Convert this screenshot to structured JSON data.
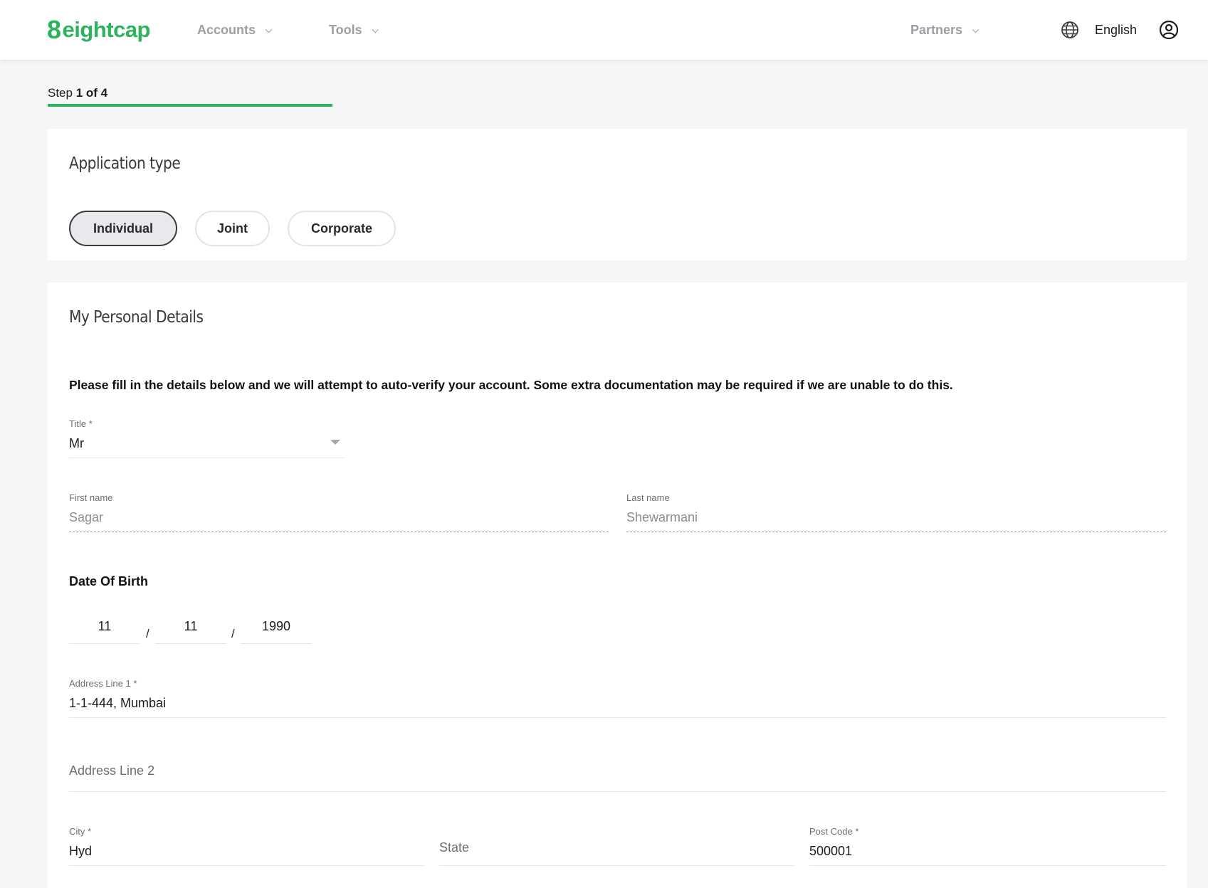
{
  "header": {
    "logo_text": "eightcap",
    "logo_mark": "8",
    "nav": [
      {
        "label": "Accounts"
      },
      {
        "label": "Tools"
      },
      {
        "label": "Partners"
      }
    ],
    "language": "English",
    "icons": {
      "language": "globe-icon",
      "account": "user-circle-icon",
      "dropdown": "chevron-down-icon"
    }
  },
  "step": {
    "prefix": "Step",
    "current": "1 of 4"
  },
  "application_type": {
    "title": "Application type",
    "options": [
      {
        "label": "Individual",
        "selected": true
      },
      {
        "label": "Joint",
        "selected": false
      },
      {
        "label": "Corporate",
        "selected": false
      }
    ]
  },
  "personal": {
    "title": "My Personal Details",
    "intro": "Please fill in the details below and we will attempt to auto-verify your account. Some extra documentation may be required if we are unable to do this.",
    "title_field": {
      "label": "Title *",
      "value": "Mr"
    },
    "first_name": {
      "label": "First name",
      "value": "Sagar"
    },
    "last_name": {
      "label": "Last name",
      "value": "Shewarmani"
    },
    "dob": {
      "label": "Date Of Birth",
      "day": "11",
      "month": "11",
      "year": "1990",
      "separator": "/"
    },
    "address1": {
      "label": "Address Line 1 *",
      "value": "1-1-444, Mumbai"
    },
    "address2": {
      "placeholder": "Address Line 2"
    },
    "city": {
      "label": "City *",
      "value": "Hyd"
    },
    "state": {
      "placeholder": "State"
    },
    "postcode": {
      "label": "Post Code *",
      "value": "500001"
    }
  },
  "colors": {
    "brand": "#2db35d",
    "background": "#f5f6f7",
    "card": "#ffffff"
  }
}
